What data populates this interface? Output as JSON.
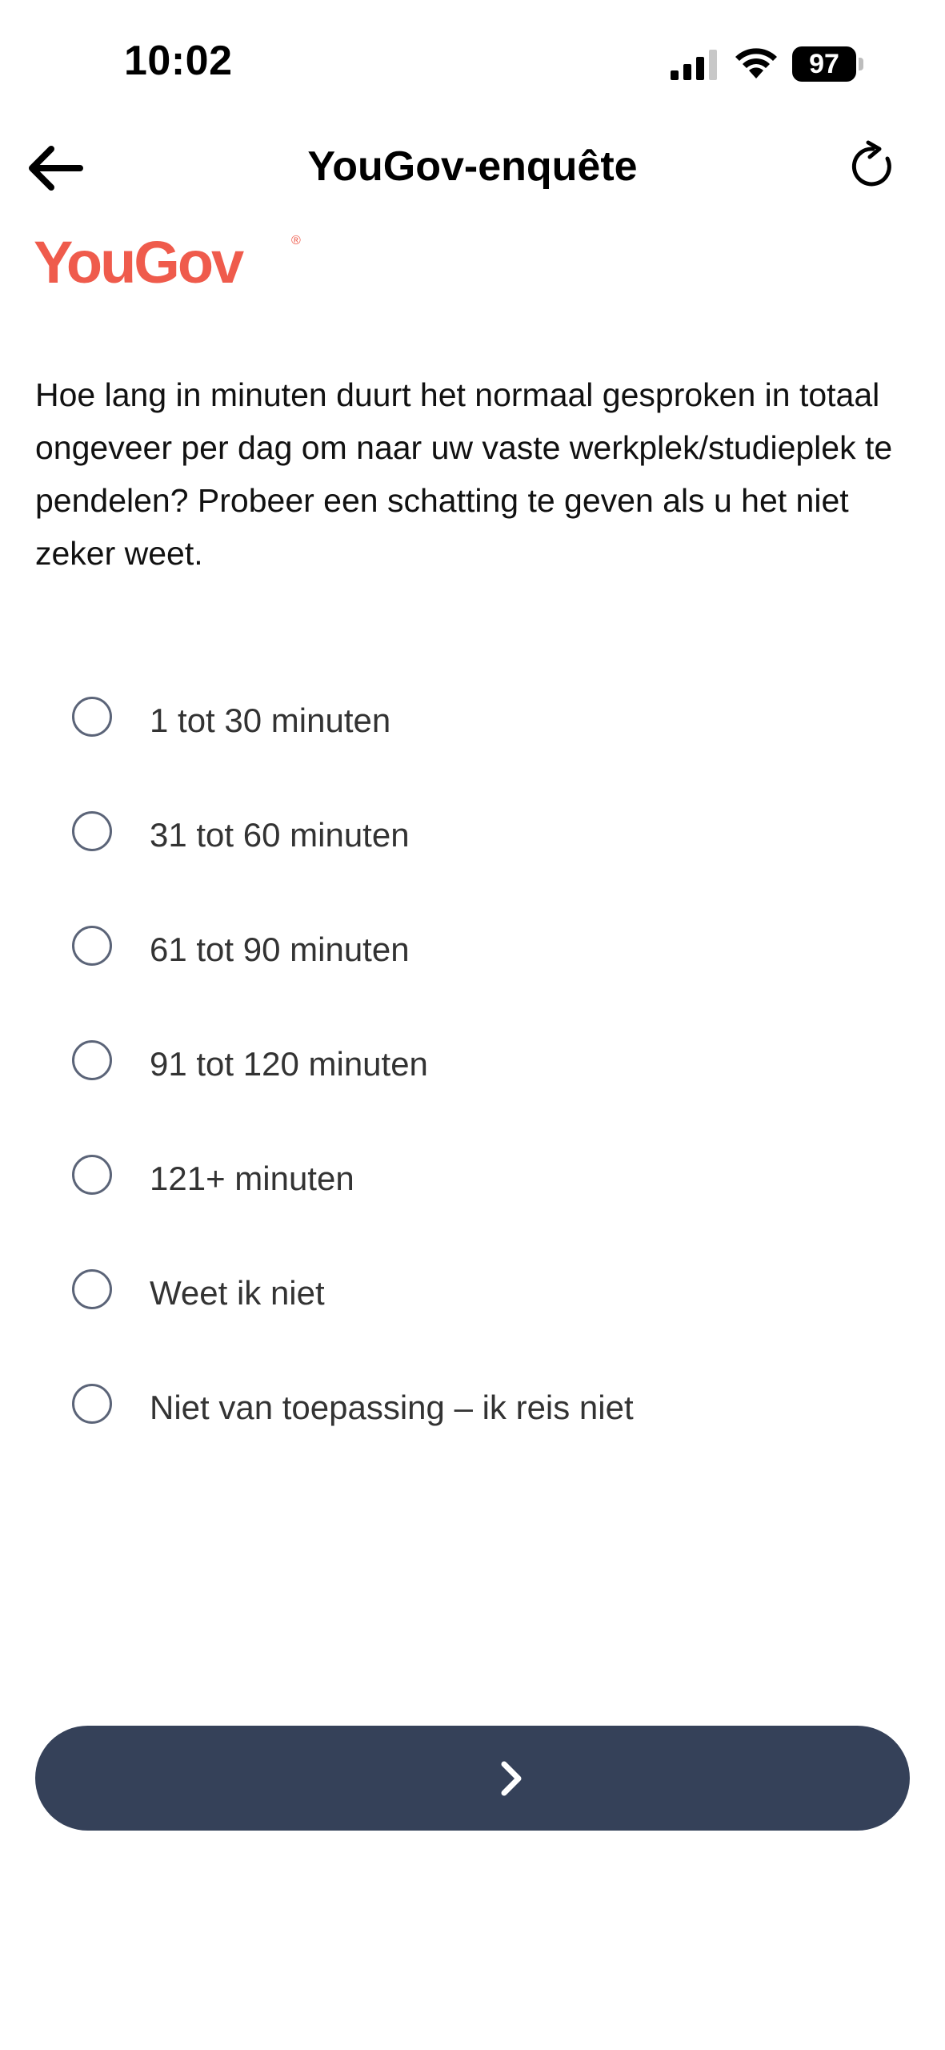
{
  "status_bar": {
    "time": "10:02",
    "battery": "97",
    "icons": [
      "signal-icon",
      "wifi-icon",
      "battery-icon"
    ]
  },
  "header": {
    "title": "YouGov-enquête",
    "back_icon": "arrow-left-icon",
    "refresh_icon": "refresh-icon"
  },
  "logo": {
    "text": "YouGov",
    "reg": "®",
    "color": "#ef5b4c"
  },
  "question": {
    "text": "Hoe lang in minuten duurt het normaal gesproken in totaal ongeveer per dag om naar uw vaste werkplek/studieplek te pendelen? Probeer een schatting te geven als u het niet zeker weet."
  },
  "options": [
    {
      "label": "1 tot 30 minuten",
      "selected": false
    },
    {
      "label": "31 tot 60 minuten",
      "selected": false
    },
    {
      "label": "61 tot 90 minuten",
      "selected": false
    },
    {
      "label": "91 tot 120 minuten",
      "selected": false
    },
    {
      "label": "121+ minuten",
      "selected": false
    },
    {
      "label": "Weet ik niet",
      "selected": false
    },
    {
      "label": "Niet van toepassing – ik reis niet",
      "selected": false
    }
  ],
  "next_button": {
    "icon": "chevron-right-icon",
    "color": "#354159"
  }
}
